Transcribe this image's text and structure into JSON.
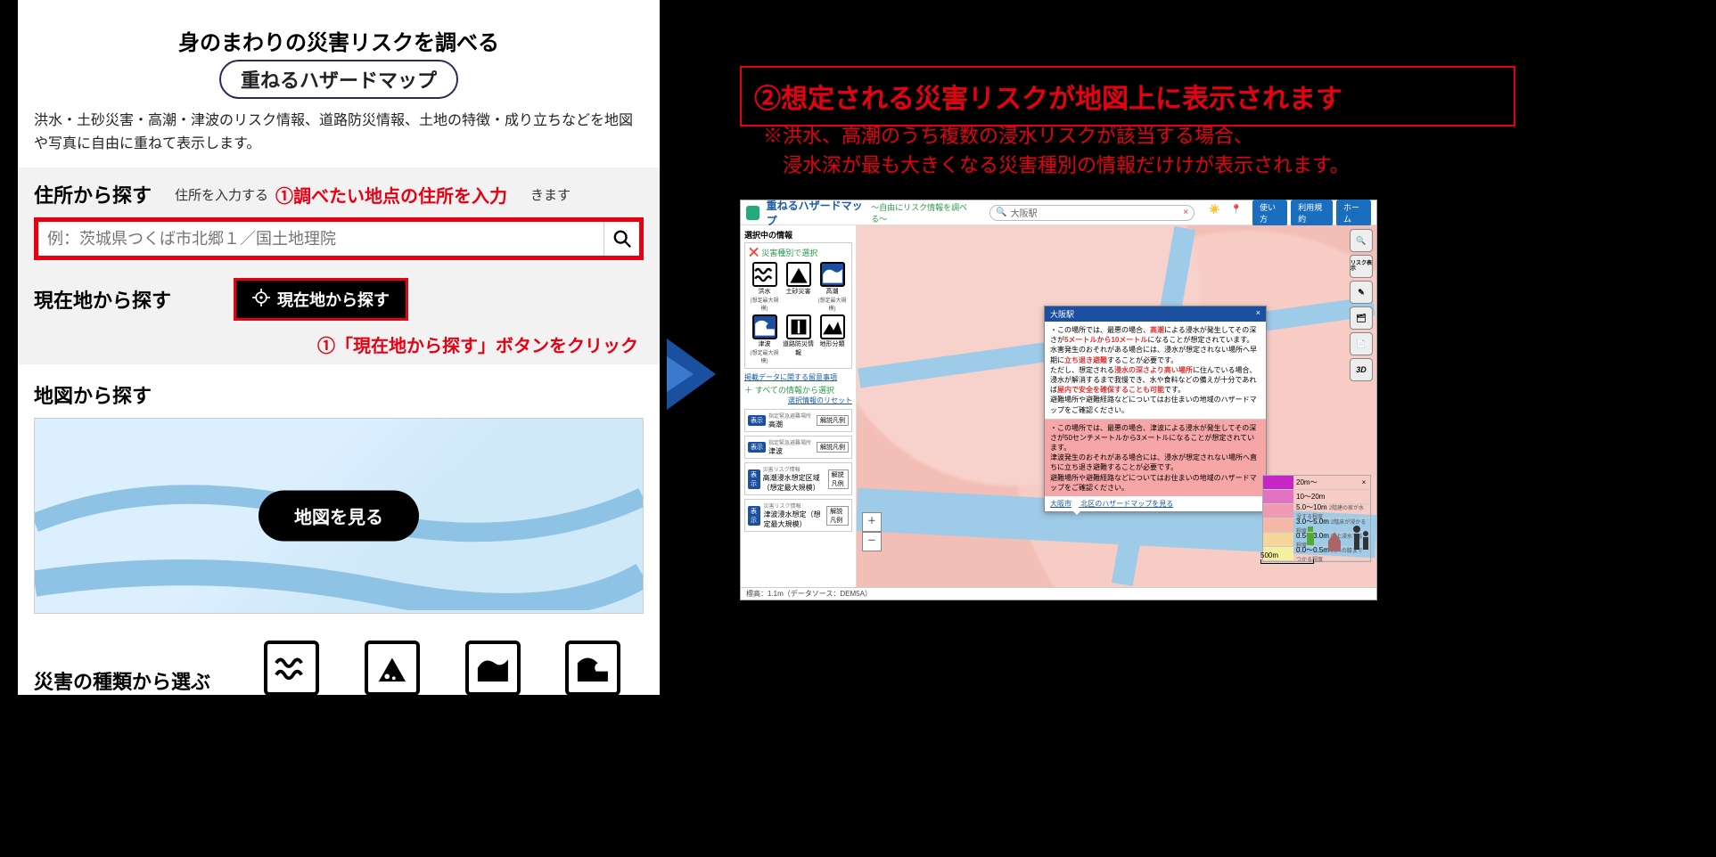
{
  "left": {
    "title": "身のまわりの災害リスクを調べる",
    "subtitle": "重ねるハザードマップ",
    "description": "洪水・土砂災害・高潮・津波のリスク情報、道路防災情報、土地の特徴・成り立ちなどを地図や写真に自由に重ねて表示します。",
    "address": {
      "label": "住所から探す",
      "help_pre": "住所を入力する",
      "help_post": "きます",
      "callout": "①調べたい地点の住所を入力",
      "placeholder": "例：茨城県つくば市北郷１／国土地理院"
    },
    "current": {
      "label": "現在地から探す",
      "button": "現在地から探す",
      "callout": "①「現在地から探す」ボタンをクリック"
    },
    "map": {
      "label": "地図から探す",
      "button": "地図を見る"
    },
    "kind": {
      "label": "災害の種類から選ぶ",
      "items": [
        "洪水",
        "土砂災害",
        "高潮",
        "津波"
      ]
    }
  },
  "right": {
    "headline": "②想定される災害リスクが地図上に表示されます",
    "note1": "※洪水、高潮のうち複数の浸水リスクが該当する場合、",
    "note2": "　浸水深が最も大きくなる災害種別の情報だけけが表示されます。"
  },
  "app": {
    "title": "重ねるハザードマップ",
    "tagline": "～自由にリスク情報を調べる～",
    "search_value": "大阪駅",
    "top_buttons": [
      "使い方",
      "利用規約",
      "ホーム"
    ],
    "sidebar": {
      "selecting": "選択中の情報",
      "by_type": "災害種別で選択",
      "hazards": [
        {
          "label": "洪水",
          "sub": "(想定最大規模)"
        },
        {
          "label": "土砂災害",
          "sub": ""
        },
        {
          "label": "高潮",
          "sub": "(想定最大規模)"
        },
        {
          "label": "津波",
          "sub": "(想定最大規模)"
        },
        {
          "label": "道路防災情報",
          "sub": ""
        },
        {
          "label": "地形分類",
          "sub": ""
        }
      ],
      "link_notice": "掲載データに関する留意事項",
      "all_select": "すべての情報から選択",
      "reset": "選択情報のリセット",
      "layers": [
        {
          "badge": "表示",
          "cat": "指定緊急避難場所",
          "name": "高潮",
          "btn": "解説凡例"
        },
        {
          "badge": "表示",
          "cat": "指定緊急避難場所",
          "name": "津波",
          "btn": "解説凡例"
        },
        {
          "badge": "表示",
          "cat": "災害リスク情報",
          "name": "高潮浸水想定区域（想定最大規模）",
          "btn": "解説凡例"
        },
        {
          "badge": "表示",
          "cat": "災害リスク情報",
          "name": "津波浸水想定（想定最大規模）",
          "btn": "解説凡例"
        }
      ]
    },
    "popup": {
      "title": "大阪駅",
      "p1a": "・この場所では、最悪の場合、",
      "p1b": "高潮",
      "p1c": "による浸水が発生してその深さが",
      "p1d": "5メートルから10メートル",
      "p1e": "になることが想定されています。",
      "p2": "水害発生のおそれがある場合には、浸水が想定されない場所へ早期に",
      "p2b": "立ち退き避難",
      "p2c": "することが必要です。",
      "p3a": "ただし、想定される",
      "p3b": "浸水の深さより高い場所",
      "p3c": "に住んでいる場合、浸水が解消するまで我慢でき、水や食料などの備えが十分であれば",
      "p3d": "屋内で安全を確保することも可能",
      "p3e": "です。",
      "p4": "避難場所や避難経路などについてはお住まいの地域のハザードマップをご確認ください。",
      "t1a": "・この場所では、最悪の場合、",
      "t1b": "津波",
      "t1c": "による浸水が発生してその深さが",
      "t1d": "50センチメートルから3メートル",
      "t1e": "になることが想定されています。",
      "t2": "津波発生のおそれがある場合には、浸水が想定されない場所へ",
      "t2b": "直ちに立ち退き避難",
      "t2c": "することが必要です。",
      "t3": "避難場所や避難経路などについてはお住まいの地域のハザードマップをご確認ください。",
      "foot1": "大阪市",
      "foot2": "北区のハザードマップを見る"
    },
    "legend": [
      {
        "range": "20m～",
        "desc": ""
      },
      {
        "range": "10～20m",
        "desc": ""
      },
      {
        "range": "5.0～10m",
        "desc": "2階建の家が水没する程度"
      },
      {
        "range": "3.0～5.0m",
        "desc": "2階床が浸かる程度"
      },
      {
        "range": "0.5～3.0m",
        "desc": "床上浸水する程度"
      },
      {
        "range": "0.0～0.5m",
        "desc": "大人の膝までつかる程度"
      }
    ],
    "tools": [
      "🔍",
      "リスク表示",
      "✎",
      "🗂",
      "📄",
      "3D"
    ],
    "status": "標高：1.1m（データソース：DEM5A）",
    "scale": "500m"
  }
}
